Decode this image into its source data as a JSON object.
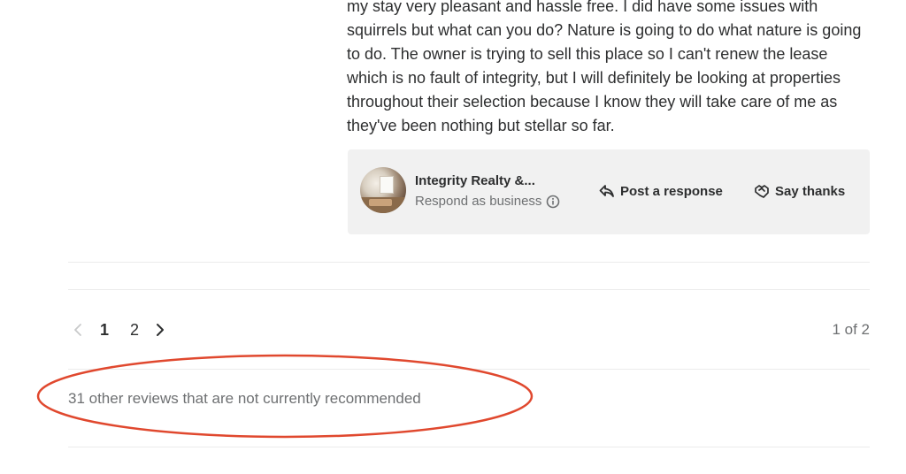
{
  "review": {
    "text": "my stay very pleasant and hassle free. I did have some issues with squirrels but what can you do? Nature is going to do what nature is going to do. The owner is trying to sell this place so I can't renew the lease which is no fault of integrity, but I will definitely be looking at properties throughout their selection because I know they will take care of me as they've been nothing but stellar so far."
  },
  "business_card": {
    "name": "Integrity Realty &...",
    "subtitle": "Respond as business",
    "post_response_label": "Post a response",
    "say_thanks_label": "Say thanks"
  },
  "pagination": {
    "pages": [
      "1",
      "2"
    ],
    "current": "1",
    "summary": "1 of 2"
  },
  "not_recommended": {
    "label": "31 other reviews that are not currently recommended"
  },
  "colors": {
    "annotation_red": "#e0482e",
    "card_bg": "#f1f1f1",
    "muted_text": "#6e7072"
  },
  "icons": {
    "info": "info-icon",
    "reply": "reply-arrow-icon",
    "thanks": "handshake-icon",
    "prev": "chevron-left-icon",
    "next": "chevron-right-icon"
  }
}
